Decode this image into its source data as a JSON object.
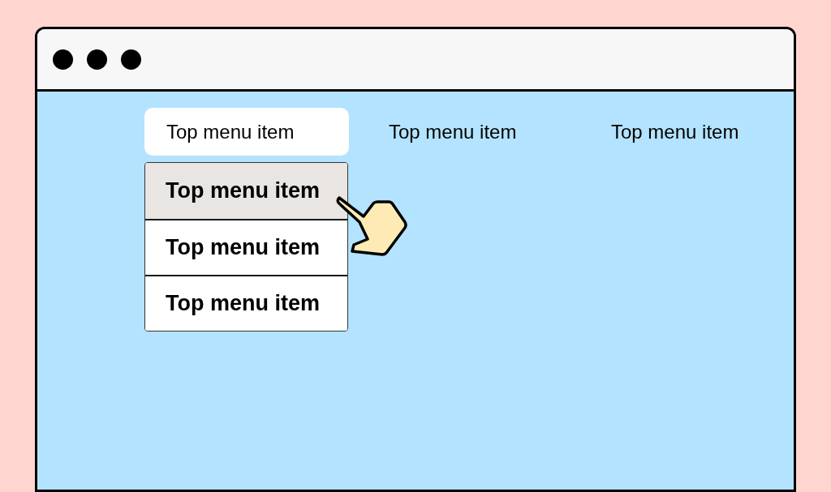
{
  "top_menu": [
    {
      "label": "Top menu item",
      "selected": true
    },
    {
      "label": "Top menu item",
      "selected": false
    },
    {
      "label": "Top menu item",
      "selected": false
    }
  ],
  "dropdown": [
    {
      "label": "Top menu item",
      "highlighted": true
    },
    {
      "label": "Top menu item",
      "highlighted": false
    },
    {
      "label": "Top menu item",
      "highlighted": false
    }
  ]
}
